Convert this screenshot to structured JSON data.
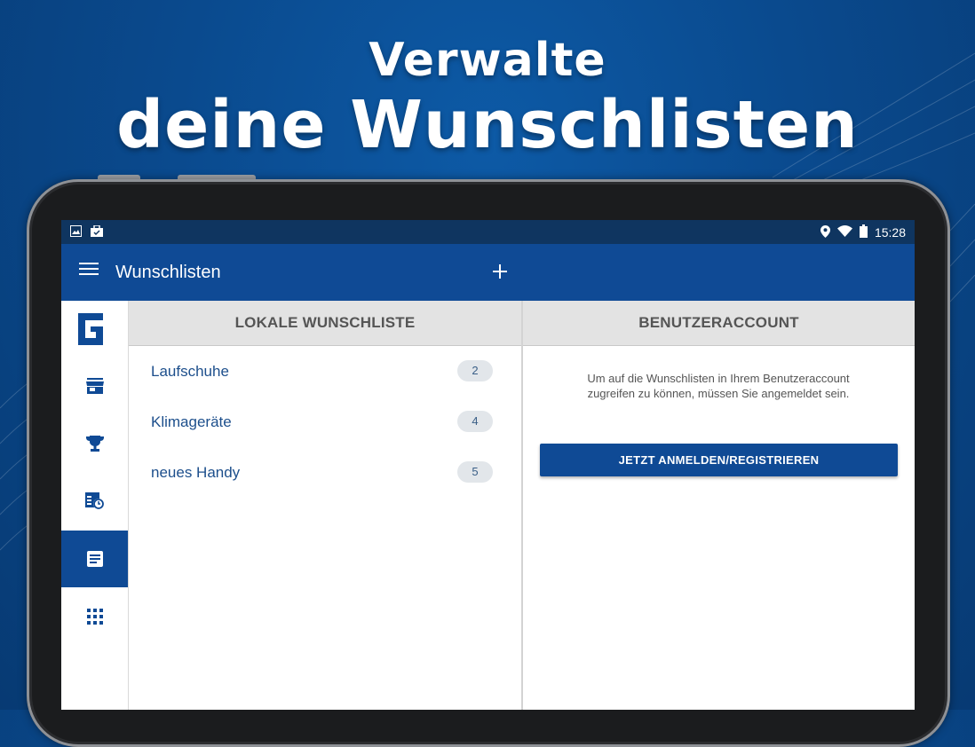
{
  "headline": {
    "line1": "Verwalte",
    "line2": "deine Wunschlisten"
  },
  "statusbar": {
    "time": "15:28",
    "left_icons": [
      "image-icon",
      "briefcase-icon"
    ],
    "right_icons": [
      "location-icon",
      "wifi-icon",
      "battery-icon"
    ]
  },
  "appbar": {
    "title": "Wunschlisten",
    "add_icon": "plus-icon",
    "menu_icon": "hamburger-icon"
  },
  "rail": {
    "items": [
      {
        "name": "logo",
        "active": false
      },
      {
        "name": "store-icon",
        "active": false
      },
      {
        "name": "trophy-icon",
        "active": false
      },
      {
        "name": "price-history-icon",
        "active": false
      },
      {
        "name": "wishlist-icon",
        "active": true
      },
      {
        "name": "apps-grid-icon",
        "active": false
      }
    ]
  },
  "local": {
    "header": "LOKALE WUNSCHLISTE",
    "items": [
      {
        "label": "Laufschuhe",
        "count": "2"
      },
      {
        "label": "Klimageräte",
        "count": "4"
      },
      {
        "label": "neues Handy",
        "count": "5"
      }
    ]
  },
  "account": {
    "header": "BENUTZERACCOUNT",
    "message_line1": "Um auf die Wunschlisten in Ihrem Benutzeraccount",
    "message_line2": "zugreifen zu können, müssen Sie angemeldet sein.",
    "login_label": "JETZT ANMELDEN/REGISTRIEREN"
  },
  "colors": {
    "primary": "#0f4a95",
    "statusbar": "#0f3560",
    "header_bg": "#e3e3e3",
    "link": "#1d4f8c",
    "background": "#0a4a8e"
  }
}
